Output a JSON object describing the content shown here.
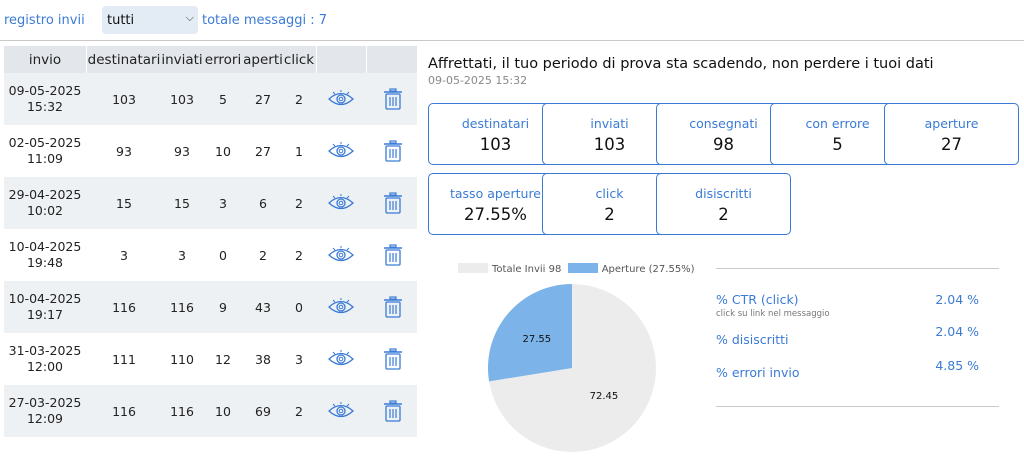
{
  "toolbar": {
    "registro_label": "registro invii",
    "filter_value": "tutti",
    "totale_label": "totale messaggi : 7"
  },
  "table": {
    "headers": [
      "invio",
      "destinatari",
      "inviati",
      "errori",
      "aperti",
      "click"
    ],
    "rows": [
      {
        "date": "09-05-2025",
        "time": "15:32",
        "destinatari": "103",
        "inviati": "103",
        "errori": "5",
        "aperti": "27",
        "click": "2"
      },
      {
        "date": "02-05-2025",
        "time": "11:09",
        "destinatari": "93",
        "inviati": "93",
        "errori": "10",
        "aperti": "27",
        "click": "1"
      },
      {
        "date": "29-04-2025",
        "time": "10:02",
        "destinatari": "15",
        "inviati": "15",
        "errori": "3",
        "aperti": "6",
        "click": "2"
      },
      {
        "date": "10-04-2025",
        "time": "19:48",
        "destinatari": "3",
        "inviati": "3",
        "errori": "0",
        "aperti": "2",
        "click": "2"
      },
      {
        "date": "10-04-2025",
        "time": "19:17",
        "destinatari": "116",
        "inviati": "116",
        "errori": "9",
        "aperti": "43",
        "click": "0"
      },
      {
        "date": "31-03-2025",
        "time": "12:00",
        "destinatari": "111",
        "inviati": "110",
        "errori": "12",
        "aperti": "38",
        "click": "3"
      },
      {
        "date": "27-03-2025",
        "time": "12:09",
        "destinatari": "116",
        "inviati": "116",
        "errori": "10",
        "aperti": "69",
        "click": "2"
      }
    ],
    "row_icons": [
      "eye-icon",
      "trash-icon"
    ]
  },
  "detail": {
    "trial_message": "Affrettati, il tuo periodo di prova sta scadendo, non perdere i tuoi dati",
    "date": "09-05-2025 15:32",
    "cards": [
      {
        "label": "destinatari",
        "value": "103"
      },
      {
        "label": "inviati",
        "value": "103"
      },
      {
        "label": "consegnati",
        "value": "98"
      },
      {
        "label": "con errore",
        "value": "5"
      },
      {
        "label": "aperture",
        "value": "27"
      },
      {
        "label": "tasso aperture",
        "value": "27.55%"
      },
      {
        "label": "click",
        "value": "2"
      },
      {
        "label": "disiscritti",
        "value": "2"
      }
    ]
  },
  "chart_data": {
    "type": "pie",
    "legend": [
      "Totale Invii 98",
      "Aperture  (27.55%)"
    ],
    "series": [
      {
        "name": "Totale Invii 98",
        "value": 72.45,
        "label": "72.45",
        "color": "#ececec"
      },
      {
        "name": "Aperture  (27.55%)",
        "value": 27.55,
        "label": "27.55",
        "color": "#7cb4ea"
      }
    ]
  },
  "stats": [
    {
      "label": "% CTR (click)",
      "value": "2.04 %",
      "note": "click su link nel messaggio"
    },
    {
      "label": "% disiscritti",
      "value": "2.04 %"
    },
    {
      "label": "% errori invio",
      "value": "4.85 %"
    }
  ],
  "colors": {
    "accent": "#3a7bd5",
    "header_bg": "#e3e7ec",
    "alt_row_bg": "#eef1f4"
  }
}
